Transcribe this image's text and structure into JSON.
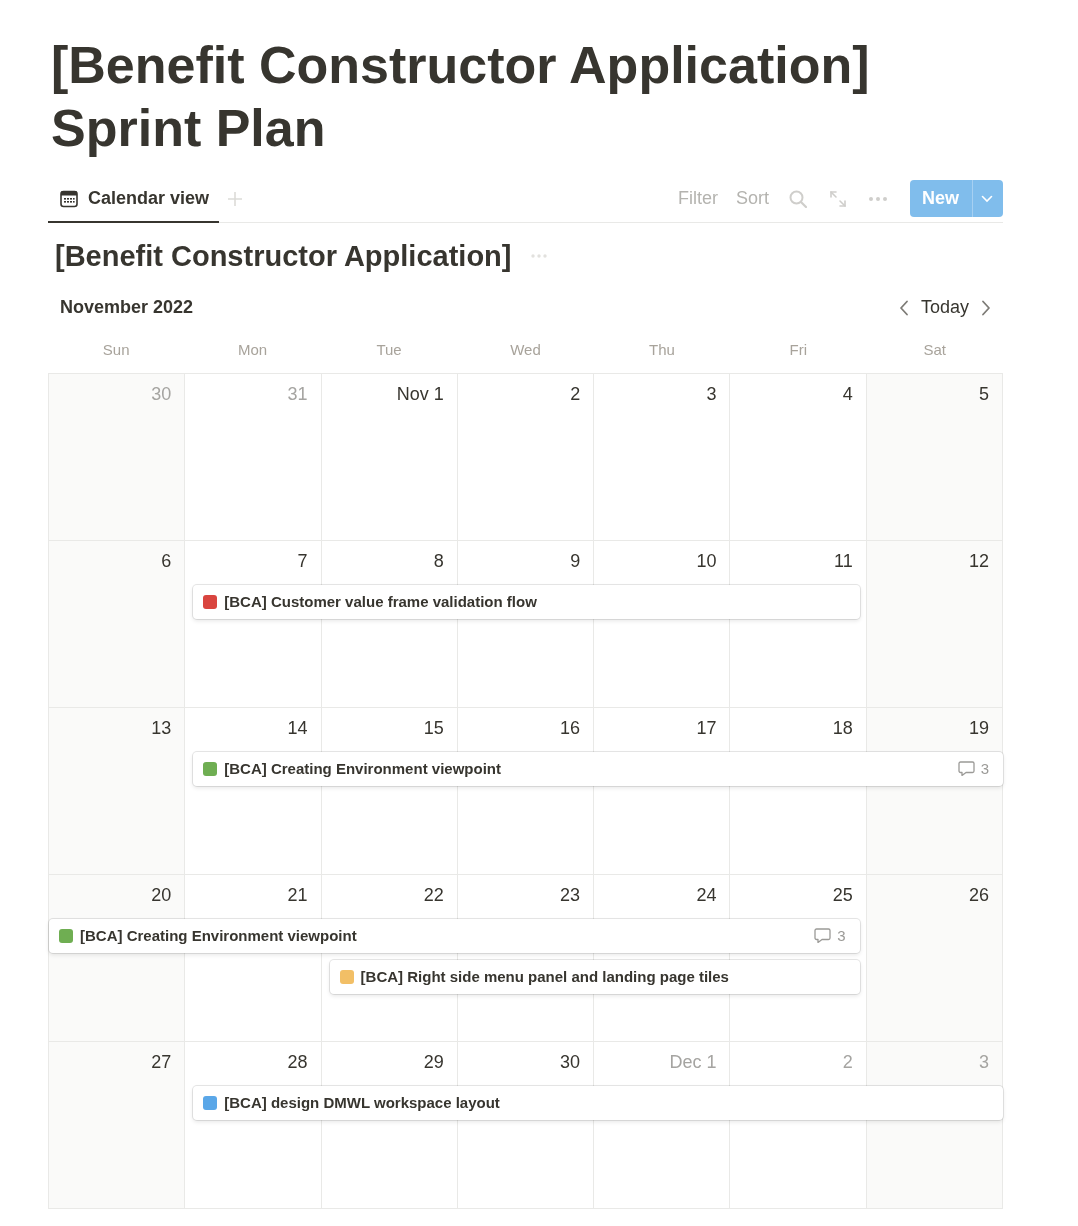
{
  "page": {
    "title": "[Benefit Constructor Application] Sprint Plan"
  },
  "views": {
    "tabs": [
      {
        "label": "Calendar view",
        "selected": true
      }
    ],
    "toolbar": [
      {
        "kind": "text",
        "label": "Filter"
      },
      {
        "kind": "text",
        "label": "Sort"
      },
      {
        "kind": "search"
      },
      {
        "kind": "expand"
      },
      {
        "kind": "more"
      }
    ],
    "new_button": {
      "label": "New"
    }
  },
  "database": {
    "title": "[Benefit Constructor Application]"
  },
  "calendar": {
    "month": "November 2022",
    "today_button": "Today",
    "weekdays": [
      {
        "label": "Sun"
      },
      {
        "label": "Mon"
      },
      {
        "label": "Tue"
      },
      {
        "label": "Wed"
      },
      {
        "label": "Thu"
      },
      {
        "label": "Fri"
      },
      {
        "label": "Sat"
      }
    ],
    "weeks": [
      {
        "days": [
          {
            "label": "30",
            "in_month": false
          },
          {
            "label": "31",
            "in_month": false
          },
          {
            "label": "Nov 1",
            "in_month": true
          },
          {
            "label": "2",
            "in_month": true
          },
          {
            "label": "3",
            "in_month": true
          },
          {
            "label": "4",
            "in_month": true
          },
          {
            "label": "5",
            "in_month": true
          }
        ]
      },
      {
        "days": [
          {
            "label": "6",
            "in_month": true
          },
          {
            "label": "7",
            "in_month": true
          },
          {
            "label": "8",
            "in_month": true
          },
          {
            "label": "9",
            "in_month": true
          },
          {
            "label": "10",
            "in_month": true
          },
          {
            "label": "11",
            "in_month": true
          },
          {
            "label": "12",
            "in_month": true
          }
        ],
        "events": [
          {
            "kind": "mon-fri",
            "title": "[BCA] Customer value frame validation flow",
            "color": "#d9453f"
          }
        ]
      },
      {
        "days": [
          {
            "label": "13",
            "in_month": true
          },
          {
            "label": "14",
            "in_month": true
          },
          {
            "label": "15",
            "in_month": true
          },
          {
            "label": "16",
            "in_month": true
          },
          {
            "label": "17",
            "in_month": true
          },
          {
            "label": "18",
            "in_month": true
          },
          {
            "label": "19",
            "in_month": true
          }
        ],
        "events": [
          {
            "kind": "mon-sat-cont",
            "title": "[BCA] Creating Environment viewpoint",
            "color": "#6fae52",
            "comments": "3"
          }
        ]
      },
      {
        "days": [
          {
            "label": "20",
            "in_month": true
          },
          {
            "label": "21",
            "in_month": true
          },
          {
            "label": "22",
            "in_month": true
          },
          {
            "label": "23",
            "in_month": true
          },
          {
            "label": "24",
            "in_month": true
          },
          {
            "label": "25",
            "in_month": true
          },
          {
            "label": "26",
            "in_month": true
          }
        ],
        "events": [
          {
            "kind": "cont-sun-fri",
            "title": "[BCA] Creating Environment viewpoint",
            "color": "#6fae52",
            "comments": "3"
          },
          {
            "kind": "tue-fri",
            "title": "[BCA] Right side menu panel and landing page tiles",
            "color": "#f2bf66"
          }
        ]
      },
      {
        "days": [
          {
            "label": "27",
            "in_month": true
          },
          {
            "label": "28",
            "in_month": true
          },
          {
            "label": "29",
            "in_month": true
          },
          {
            "label": "30",
            "in_month": true
          },
          {
            "label": "Dec 1",
            "in_month": false
          },
          {
            "label": "2",
            "in_month": false
          },
          {
            "label": "3",
            "in_month": false
          }
        ],
        "events": [
          {
            "kind": "mon-sat-cont",
            "title": "[BCA] design DMWL workspace layout",
            "color": "#5aa7e8"
          }
        ]
      }
    ]
  }
}
